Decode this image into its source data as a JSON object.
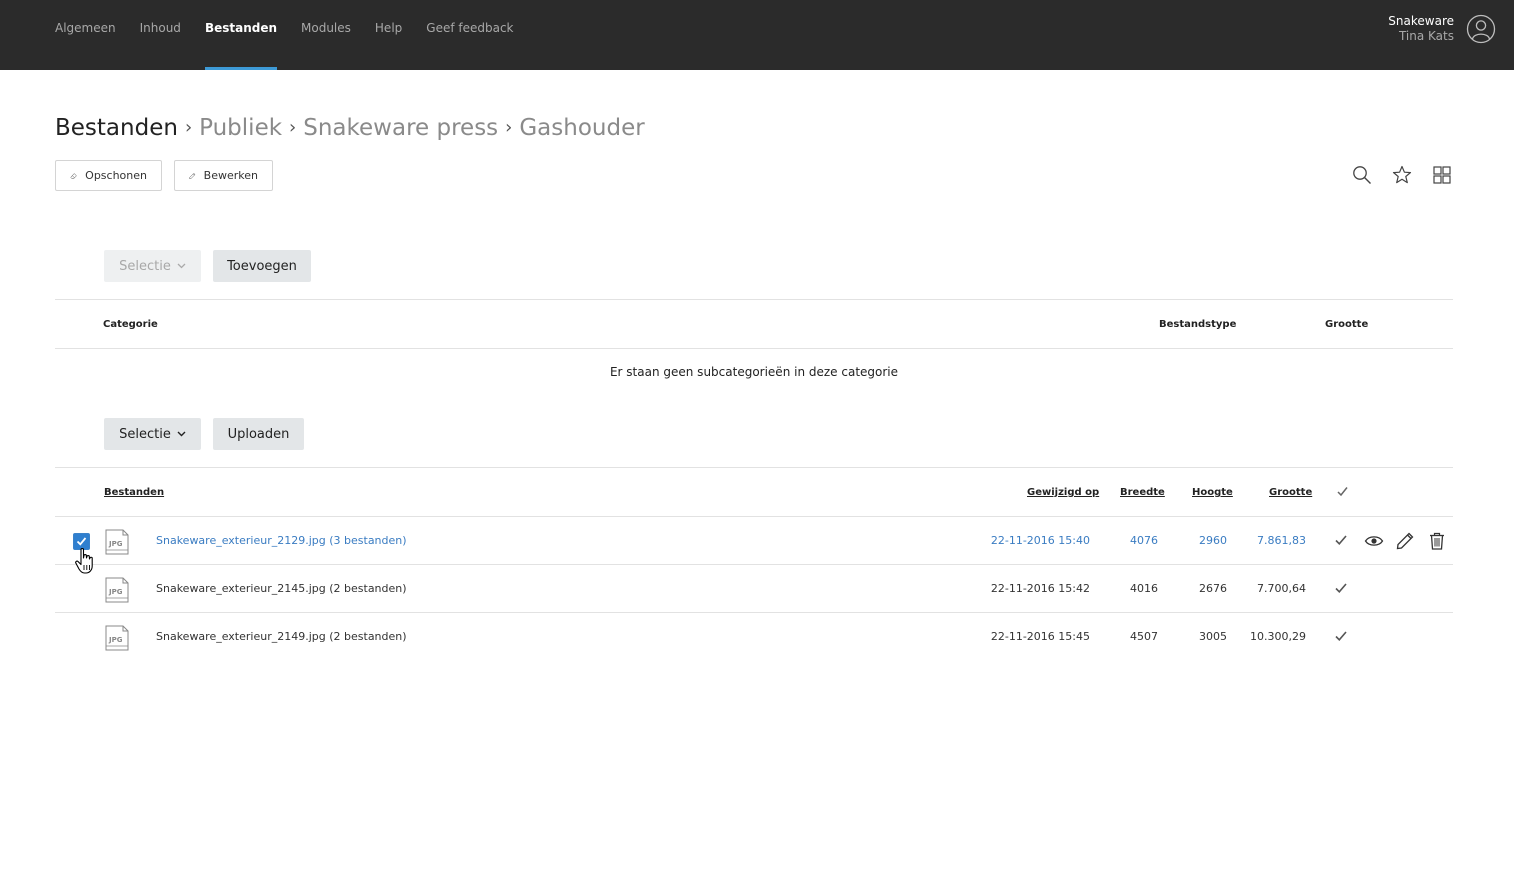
{
  "nav": {
    "items": [
      {
        "label": "Algemeen",
        "active": false
      },
      {
        "label": "Inhoud",
        "active": false
      },
      {
        "label": "Bestanden",
        "active": true
      },
      {
        "label": "Modules",
        "active": false
      },
      {
        "label": "Help",
        "active": false
      },
      {
        "label": "Geef feedback",
        "active": false
      }
    ],
    "org": "Snakeware",
    "user": "Tina Kats"
  },
  "breadcrumb": {
    "root": "Bestanden",
    "items": [
      "Publiek",
      "Snakeware press",
      "Gashouder"
    ]
  },
  "toolbar": {
    "clean_label": "Opschonen",
    "edit_label": "Bewerken"
  },
  "categories": {
    "select_label": "Selectie",
    "add_label": "Toevoegen",
    "headers": {
      "category": "Categorie",
      "filetype": "Bestandstype",
      "size": "Grootte"
    },
    "empty_message": "Er staan geen subcategorieën in deze categorie"
  },
  "files": {
    "select_label": "Selectie",
    "upload_label": "Uploaden",
    "headers": {
      "name": "Bestanden",
      "modified": "Gewijzigd op",
      "width": "Breedte",
      "height": "Hoogte",
      "size": "Grootte"
    },
    "icon_label": "JPG",
    "rows": [
      {
        "name": "Snakeware_exterieur_2129.jpg (3 bestanden)",
        "modified": "22-11-2016 15:40",
        "width": "4076",
        "height": "2960",
        "size": "7.861,83",
        "selected": true
      },
      {
        "name": "Snakeware_exterieur_2145.jpg (2 bestanden)",
        "modified": "22-11-2016 15:42",
        "width": "4016",
        "height": "2676",
        "size": "7.700,64",
        "selected": false
      },
      {
        "name": "Snakeware_exterieur_2149.jpg (2 bestanden)",
        "modified": "22-11-2016 15:45",
        "width": "4507",
        "height": "3005",
        "size": "10.300,29",
        "selected": false
      }
    ]
  },
  "colors": {
    "topbar": "#2b2b2b",
    "accent": "#3d9ad6",
    "link": "#3a7cc2"
  }
}
